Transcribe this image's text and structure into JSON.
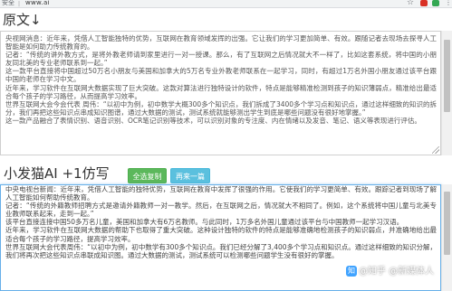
{
  "browser": {
    "security_label": "安全",
    "url_text": "www.ai",
    "star_icon": "star-icon",
    "menu_icon": "kebab-menu-icon"
  },
  "original": {
    "heading": "原文↓",
    "paragraphs": [
      "央视网消息：近年来，凭借人工智能独特的优势，互联网在教育领域发挥的出强。它让我们的学习更加简单、有效。跟随记者去现场去探寻人工智能是如何助力传统教育的。",
      "记者：“传统的讲外教方式，是将外教老师请到家里进行一对一授课。那么，有了互联网之后情况就大不一样了，比如这套系统，将中国的小朋友同北美的专业老师联系到一起。”",
      "这一款平台直接将中国超过50万名小朋友与美国和加拿大的5万名专业外教老师联系在一起学习，同时，有超过1万名外国小朋友通过该平台跟中国的老师在学习中文。",
      "近年来，学习软件在互联网大数据实现了巨大突破。这款对算法进行独特设计的软件，特点是能够精准检测到孩子的知识薄弱点，精准给出最适合每个孩子的学习路径，从而提高学习效率。",
      "世界互联网大会今会代表 周伟：“以初中为例，初中数学大概300多个知识点，我们拆成了3400多个学习点和知识点，通过这样细致的知识的拆分，我们再把这些知识点串成知识图谱，通过大数据的测试，测试系统就能够测出学生到底是哪些问题没有很好地掌握。”",
      "这一款产品融合了表情识别、语音识别、OCR笔记识别等技术，可以识别对象的专注度、内在情绪以及发音、笔记、语义等表现进行评估。"
    ]
  },
  "result": {
    "heading": "小发猫AI +1仿写",
    "copy_button": "全选复制",
    "again_button": "再来一篇",
    "paragraphs": [
      "中央电视台新闻：近年来，凭借人工智能的独特优势，互联网在教育中发挥了很强的作用。它使我们的学习更简单、有效。跟踪记者到现场了解人工智能如何帮助传统教育。",
      "记者：“传统的外籍教师招聘方式是邀请外籍教师一对一教学。然后，在互联网之后，情况就大不相同了。例如，这个系统将中国儿童与北美专业教师联系起来，走到一起。”",
      "该平台直接连接中国50多万名儿童，美国和加拿大有6万名教师。与此同时，1万多名外国儿童通过该平台与中国教师一起学习汉语。",
      "近年来，学习软件在互联网大数据的帮助下也取得了重大突破。这种设计独特的软件的特点是能够准确地检测孩子的知识弱点，并准确地给出最适合每个孩子的学习路径，提高学习效率。",
      "世界互联网大会代表周伟：“以初中为例，初中数学有300多个知识点。我们已经分解了3,400多个学习点和知识点。通过这样细致的知识分解，我们将再次把这些知识点串联成知识图。通过大数据的测试，测试系统可以检测哪些问题学生没有很好的掌握。"
    ]
  },
  "watermark": {
    "logo_text": "知",
    "text": "@知乎 @新媒体人"
  },
  "colors": {
    "copy_button_bg": "#5cb85c",
    "again_button_bg": "#5bc0de",
    "focus_border": "#66afe9"
  }
}
